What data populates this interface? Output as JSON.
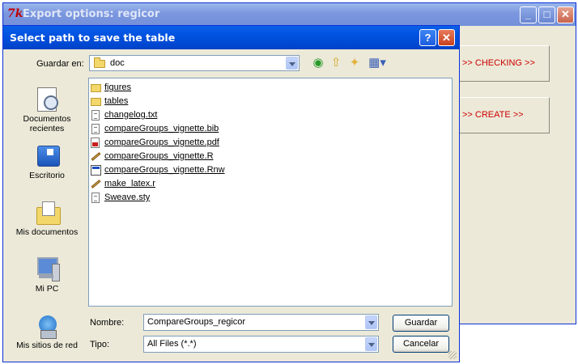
{
  "background_window": {
    "title": "Export options: regicor",
    "logo_text": "7k",
    "checking_button": ">> CHECKING >>",
    "create_button": ">> CREATE >>"
  },
  "dialog": {
    "title": "Select path to save the table",
    "help_glyph": "?",
    "close_glyph": "✕",
    "lookin_label": "Guardar en:",
    "lookin_value": "doc",
    "places": [
      {
        "label": "Documentos recientes",
        "icon": "recent-documents-icon"
      },
      {
        "label": "Escritorio",
        "icon": "desktop-icon"
      },
      {
        "label": "Mis documentos",
        "icon": "my-documents-icon"
      },
      {
        "label": "Mi PC",
        "icon": "my-computer-icon"
      },
      {
        "label": "Mis sitios de red",
        "icon": "network-places-icon"
      }
    ],
    "files": [
      {
        "name": "figures",
        "type": "folder"
      },
      {
        "name": "tables",
        "type": "folder"
      },
      {
        "name": "changelog.txt",
        "type": "text"
      },
      {
        "name": "compareGroups_vignette.bib",
        "type": "doc"
      },
      {
        "name": "compareGroups_vignette.pdf",
        "type": "pdf"
      },
      {
        "name": "compareGroups_vignette.R",
        "type": "edit"
      },
      {
        "name": "compareGroups_vignette.Rnw",
        "type": "app"
      },
      {
        "name": "make_latex.r",
        "type": "edit"
      },
      {
        "name": "Sweave.sty",
        "type": "doc"
      }
    ],
    "filename_label": "Nombre:",
    "filename_value": "CompareGroups_regicor",
    "filetype_label": "Tipo:",
    "filetype_value": "All Files (*.*)",
    "save_button": "Guardar",
    "cancel_button": "Cancelar"
  }
}
